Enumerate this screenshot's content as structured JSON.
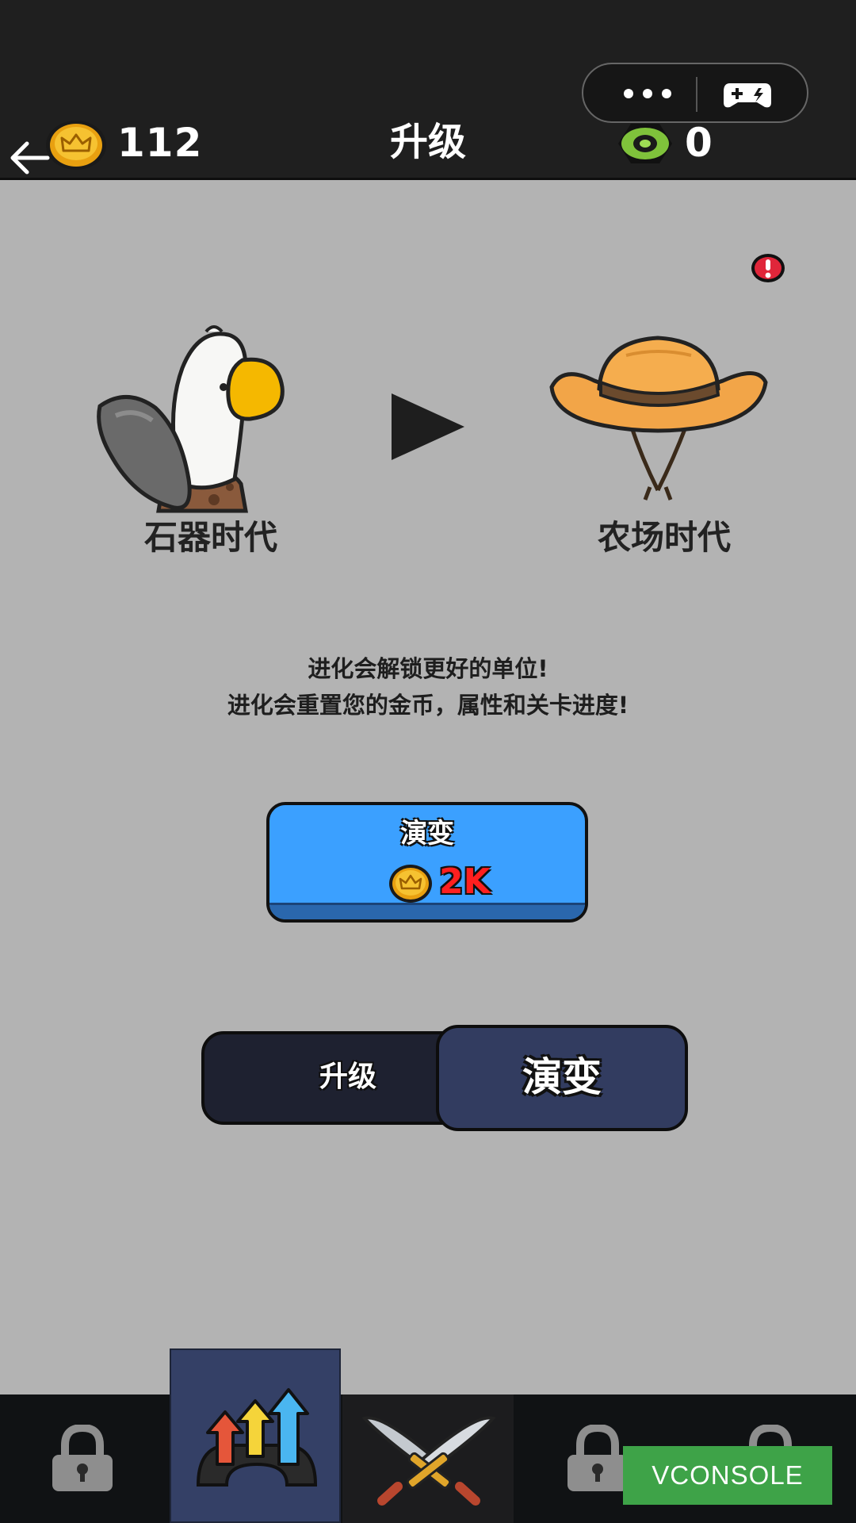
{
  "header": {
    "title": "升级",
    "coins": "112",
    "gems": "0",
    "back_icon": "back-arrow-icon",
    "menu_icon": "more-dots-icon",
    "gamepad_icon": "gamepad-icon"
  },
  "evolution": {
    "from_era": "石器时代",
    "to_era": "农场时代",
    "description_line1": "进化会解锁更好的单位!",
    "description_line2": "进化会重置您的金币，属性和关卡进度!",
    "button_label": "演变",
    "cost": "2K"
  },
  "tabs": {
    "left_label": "升级",
    "right_label": "演变",
    "selected": "演变"
  },
  "bottom_nav": {
    "items": [
      "lock-icon",
      "upgrade-arrows-icon",
      "crossed-swords-icon",
      "lock-icon",
      "lock-icon"
    ],
    "active_index": 1
  },
  "debug": {
    "vconsole_label": "VCONSOLE"
  },
  "colors": {
    "background": "#b3b3b3",
    "topbar": "#1f1f1f",
    "evolve_button": "#3ba0ff",
    "cost_text": "#ff1f1f",
    "tab_active": "#323c60",
    "vconsole": "#3ea348"
  }
}
